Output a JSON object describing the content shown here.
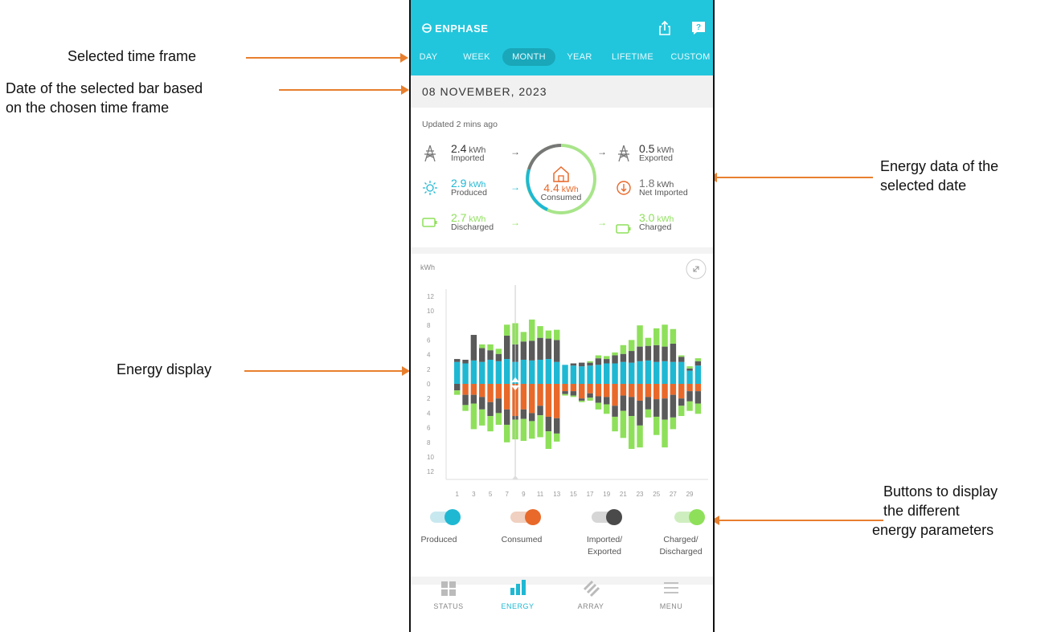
{
  "annotations": {
    "time_frame": "Selected time frame",
    "date_line1": "Date of the selected bar based",
    "date_line2": "on the chosen time frame",
    "energy_data_line1": "Energy data of the",
    "energy_data_line2": "selected date",
    "energy_display": "Energy display",
    "buttons_line1": "Buttons to display",
    "buttons_line2": "the different",
    "buttons_line3": "energy parameters"
  },
  "app": {
    "brand": "ENPHASE",
    "tabs": [
      "DAY",
      "WEEK",
      "MONTH",
      "YEAR",
      "LIFETIME",
      "CUSTOM"
    ],
    "selected_tab": "MONTH",
    "date": "08 NOVEMBER, 2023",
    "updated": "Updated 2 mins ago"
  },
  "summary": {
    "imported": {
      "value": "2.4",
      "unit": "kWh",
      "label": "Imported"
    },
    "produced": {
      "value": "2.9",
      "unit": "kWh",
      "label": "Produced"
    },
    "discharged": {
      "value": "2.7",
      "unit": "kWh",
      "label": "Discharged"
    },
    "consumed": {
      "value": "4.4",
      "unit": "kWh",
      "label": "Consumed"
    },
    "exported": {
      "value": "0.5",
      "unit": "kWh",
      "label": "Exported"
    },
    "net_imported": {
      "value": "1.8",
      "unit": "kWh",
      "label": "Net Imported"
    },
    "charged": {
      "value": "3.0",
      "unit": "kWh",
      "label": "Charged"
    }
  },
  "chart_ui": {
    "unit": "kWh"
  },
  "toggles": [
    {
      "label": "Produced",
      "label2": "",
      "color": "#1fb8d3"
    },
    {
      "label": "Consumed",
      "label2": "",
      "color": "#e8692a"
    },
    {
      "label": "Imported/",
      "label2": "Exported",
      "color": "#4a4a4a"
    },
    {
      "label": "Charged/",
      "label2": "Discharged",
      "color": "#8ee05a"
    }
  ],
  "nav": [
    {
      "label": "STATUS",
      "icon": "grid-icon"
    },
    {
      "label": "ENERGY",
      "icon": "bar-chart-icon"
    },
    {
      "label": "ARRAY",
      "icon": "panels-icon"
    },
    {
      "label": "MENU",
      "icon": "hamburger-icon"
    }
  ],
  "colors": {
    "accent": "#22c6dc",
    "produced": "#1fb8d3",
    "consumed": "#e8692a",
    "grid": "#5a5a5a",
    "battery": "#8ee05a",
    "arrow": "#e87f2e"
  },
  "chart_data": {
    "type": "bar",
    "ylabel": "kWh",
    "ylim": [
      -12,
      12
    ],
    "tick_labels_y": [
      "12",
      "10",
      "8",
      "6",
      "4",
      "2",
      "0",
      "2",
      "4",
      "6",
      "8",
      "10",
      "12"
    ],
    "x_tick_labels": [
      "1",
      "3",
      "5",
      "7",
      "9",
      "11",
      "13",
      "15",
      "17",
      "19",
      "21",
      "23",
      "25",
      "27",
      "29"
    ],
    "selected_day": 8,
    "days": [
      1,
      2,
      3,
      4,
      5,
      6,
      7,
      8,
      9,
      10,
      11,
      12,
      13,
      14,
      15,
      16,
      17,
      18,
      19,
      20,
      21,
      22,
      23,
      24,
      25,
      26,
      27,
      28,
      29,
      30
    ],
    "series": [
      {
        "name": "Produced",
        "values": [
          3.0,
          2.8,
          3.2,
          3.0,
          3.3,
          3.1,
          3.4,
          3.0,
          3.3,
          3.2,
          3.3,
          3.4,
          3.0,
          2.6,
          2.5,
          2.4,
          2.5,
          2.6,
          2.8,
          2.8,
          3.0,
          2.9,
          3.1,
          3.2,
          3.0,
          3.1,
          3.0,
          3.0,
          1.8,
          2.5
        ]
      },
      {
        "name": "Imported",
        "values": [
          0.4,
          0.5,
          3.5,
          1.9,
          1.3,
          1.0,
          3.2,
          2.4,
          2.5,
          2.7,
          3.0,
          2.8,
          3.0,
          0,
          0.3,
          0.5,
          0.4,
          0.9,
          0.6,
          1.1,
          1.1,
          1.6,
          2.0,
          2.0,
          2.3,
          2.0,
          2.5,
          0.7,
          0.3,
          0.6
        ]
      },
      {
        "name": "Charged",
        "values": [
          0,
          0,
          0,
          0.5,
          0.8,
          0.7,
          1.5,
          2.9,
          1.3,
          2.9,
          1.6,
          1.1,
          1.4,
          0,
          0,
          0,
          0.2,
          0.4,
          0.4,
          0.4,
          1.2,
          1.5,
          2.9,
          1.1,
          2.3,
          3.0,
          2.0,
          0.2,
          0.3,
          0.4
        ]
      },
      {
        "name": "Consumed",
        "values": [
          0,
          -1.5,
          -1.5,
          -1.8,
          -2.5,
          -2.0,
          -3.5,
          -4.4,
          -3.5,
          -4.0,
          -3.0,
          -4.5,
          -4.7,
          -1.0,
          -1.0,
          -2.0,
          -1.3,
          -1.7,
          -1.8,
          -3.0,
          -1.6,
          -1.8,
          -2.3,
          -1.8,
          -2.1,
          -2.0,
          -1.5,
          -2.0,
          -1.0,
          -1.0
        ]
      },
      {
        "name": "Exported",
        "values": [
          -0.9,
          -1.4,
          -1.2,
          -1.7,
          -1.9,
          -2.0,
          -2.1,
          -0.5,
          -1.3,
          -1.1,
          -1.3,
          -2.0,
          -2.1,
          -0.4,
          -0.6,
          -0.3,
          -0.6,
          -0.9,
          -1.0,
          -1.5,
          -2.1,
          -2.6,
          -3.4,
          -1.7,
          -2.4,
          -2.9,
          -3.1,
          -1.0,
          -1.4,
          -1.7
        ]
      },
      {
        "name": "Discharged",
        "values": [
          -0.6,
          -0.8,
          -3.5,
          -2.2,
          -2.1,
          -1.6,
          -2.4,
          -2.7,
          -3.0,
          -2.4,
          -3.0,
          -2.4,
          -1.1,
          -0.2,
          -0.2,
          -0.2,
          -0.4,
          -0.9,
          -1.3,
          -2.0,
          -3.7,
          -4.5,
          -3.0,
          -1.1,
          -2.5,
          -3.8,
          -1.6,
          -1.4,
          -1.3,
          -1.4
        ]
      }
    ]
  }
}
